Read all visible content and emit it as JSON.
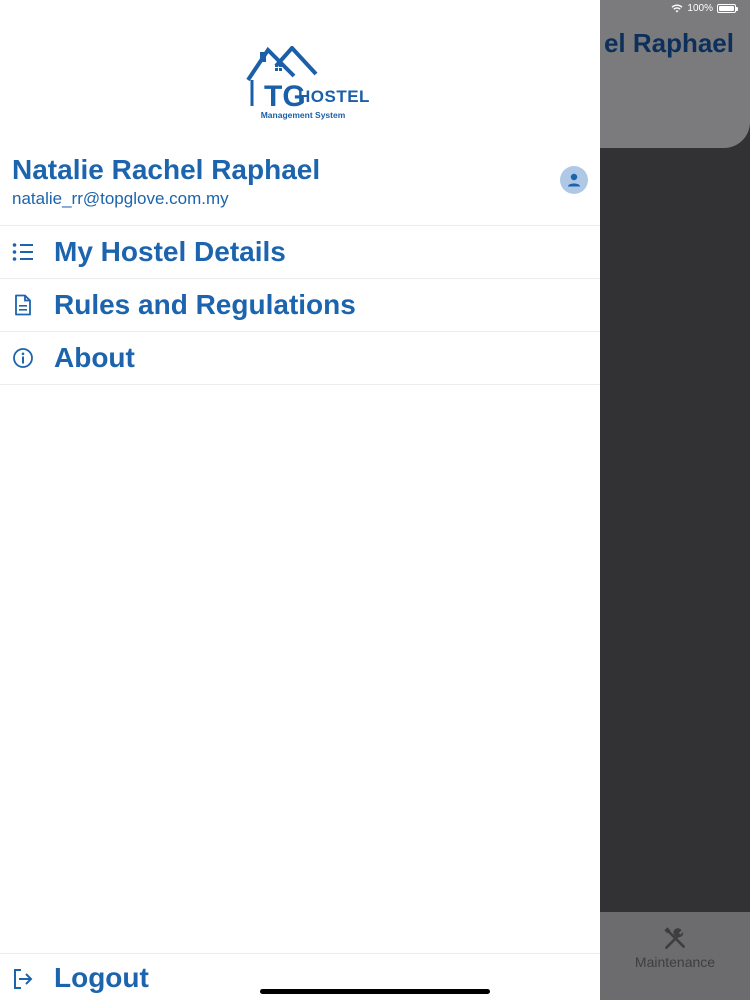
{
  "status_bar": {
    "battery": "100%"
  },
  "background": {
    "header_title": "el Raphael",
    "tab_label": "Maintenance",
    "tab_icon": "tools-icon"
  },
  "logo": {
    "initials": "TG",
    "word": "HOSTEL",
    "tagline": "Management System"
  },
  "profile": {
    "name": "Natalie Rachel Raphael",
    "email": "natalie_rr@topglove.com.my",
    "avatar_icon": "user-icon"
  },
  "menu": {
    "items": [
      {
        "label": "My Hostel Details",
        "icon": "list-icon"
      },
      {
        "label": "Rules and Regulations",
        "icon": "document-icon"
      },
      {
        "label": "About",
        "icon": "info-icon"
      }
    ],
    "logout": {
      "label": "Logout",
      "icon": "logout-icon"
    }
  },
  "colors": {
    "accent": "#1c64ad",
    "logo": "#1b5fa8",
    "avatar_bg": "#aec8e6"
  }
}
